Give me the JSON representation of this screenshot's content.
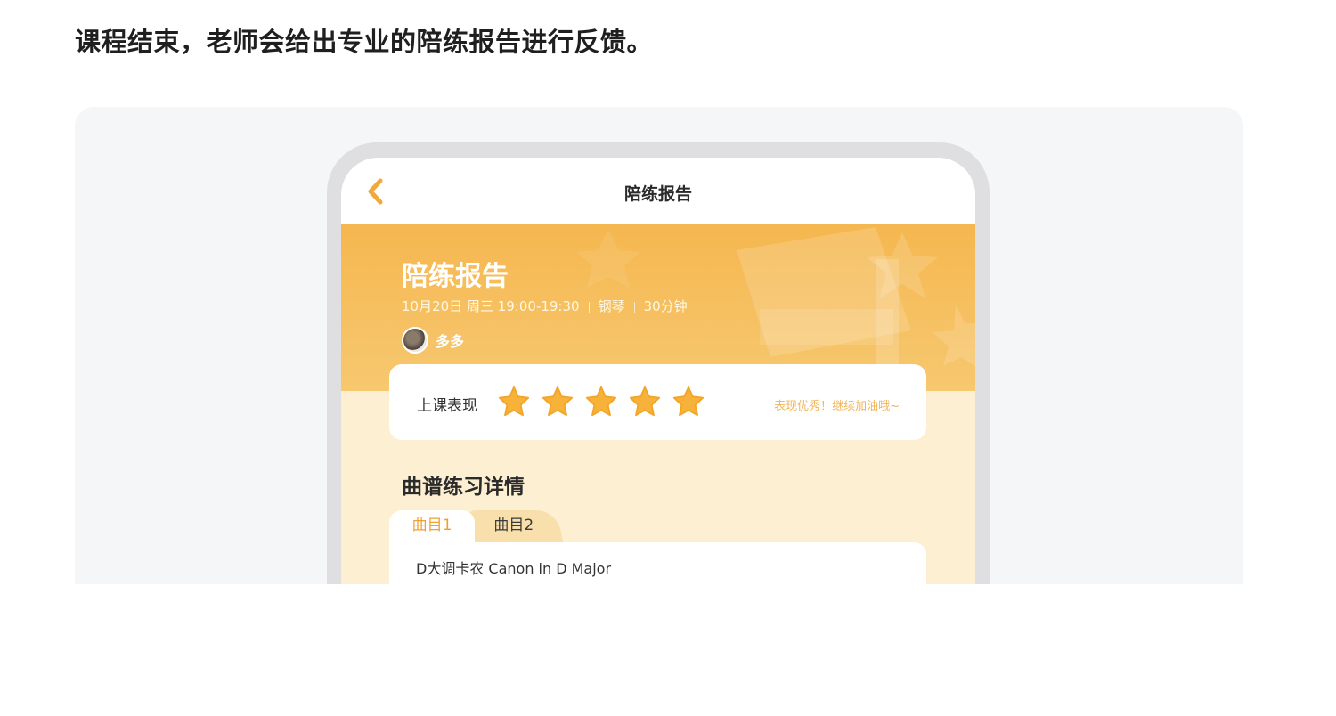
{
  "intro_text": "课程结束，老师会给出专业的陪练报告进行反馈。",
  "navbar": {
    "title": "陪练报告"
  },
  "hero": {
    "title": "陪练报告",
    "date_time": "10月20日 周三 19:00-19:30",
    "instrument": "钢琴",
    "duration": "30分钟",
    "student_name": "多多"
  },
  "performance": {
    "label": "上课表现",
    "rating": 5,
    "max_rating": 5,
    "comment": "表现优秀！继续加油哦~"
  },
  "practice": {
    "section_title": "曲谱练习详情",
    "tabs": [
      {
        "label": "曲目1"
      },
      {
        "label": "曲目2"
      }
    ],
    "song_name": "D大调卡农 Canon in D Major"
  },
  "colors": {
    "accent": "#f0a030",
    "hero_orange": "#f5b74f",
    "screen_bg": "#fdf0d2",
    "panel_bg": "#f5f6f8"
  }
}
